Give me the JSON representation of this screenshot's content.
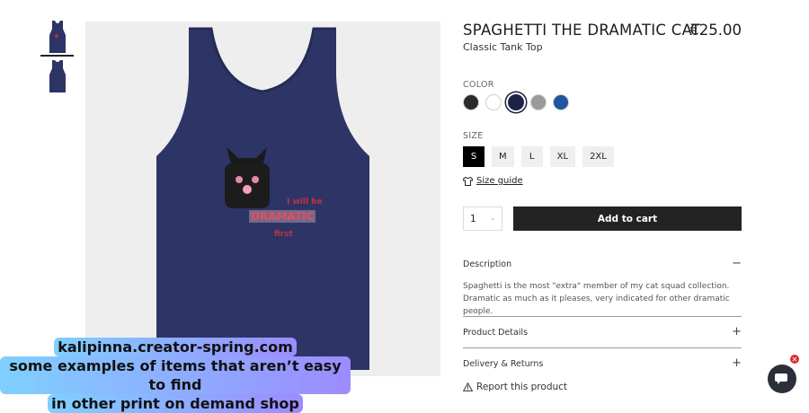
{
  "product": {
    "title": "SPAGHETTI THE DRAMATIC CAT",
    "price": "€25.00",
    "subtitle": "Classic Tank Top",
    "color_label": "COLOR",
    "colors": [
      "#2b2b2b",
      "#ffffff",
      "#1d2347",
      "#9a9a9a",
      "#1e56a0"
    ],
    "selected_color_index": 2,
    "size_label": "SIZE",
    "sizes": [
      "S",
      "M",
      "L",
      "XL",
      "2XL"
    ],
    "selected_size": "S",
    "size_guide": "Size guide",
    "quantity": "1",
    "add_to_cart": "Add to cart"
  },
  "artwork": {
    "line1": "I will be",
    "line2": "DRAMATIC",
    "line3": "first"
  },
  "accordion": {
    "description_title": "Description",
    "description_text": "Spaghetti is the most \"extra\" member of my cat squad collection. Dramatic as much as it pleases, very indicated for other dramatic people.",
    "details_title": "Product Details",
    "delivery_title": "Delivery & Returns"
  },
  "report": "Report this product",
  "promo": {
    "line1": "kalipinna.creator-spring.com",
    "line2": "some examples of items that aren’t easy to find",
    "line3": "in other print on demand shop"
  },
  "colors": {
    "tank": "#2d3566",
    "cart_button": "#232323",
    "accent": "#1b1e3a"
  }
}
